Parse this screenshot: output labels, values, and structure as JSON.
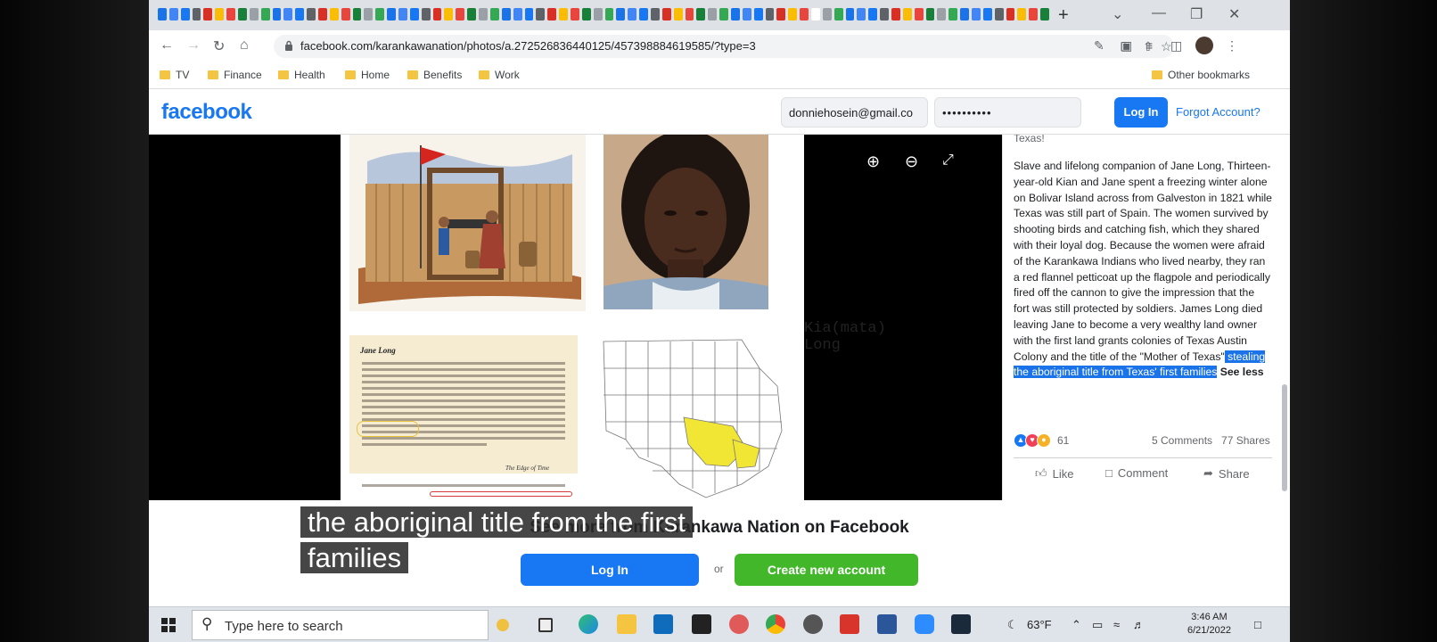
{
  "browser": {
    "url": "facebook.com/karankawanation/photos/a.272526836440125/457398884619585/?type=3",
    "bookmarks": [
      "TV",
      "Finance",
      "Health",
      "Home",
      "Benefits",
      "Work"
    ],
    "other_bookmarks": "Other bookmarks"
  },
  "fb_header": {
    "logo": "facebook",
    "email_value": "donniehosein@gmail.co",
    "password_value": "••••••••••",
    "login_label": "Log In",
    "forgot_label": "Forgot Account?"
  },
  "photo": {
    "caption_name": "Kia(mata) Long",
    "doc_title": "Jane Long",
    "doc_footer": "The Edge of Time"
  },
  "post": {
    "top_fragment": "Texas!",
    "body": "Slave and lifelong companion of Jane Long, Thirteen-year-old Kian and Jane spent a freezing winter alone on Bolivar Island across from Galveston in 1821 while Texas was still part of Spain. The women survived by shooting birds and catching fish, which they shared with their loyal dog. Because the women were afraid of the Karankawa Indians who lived nearby, they ran a red flannel petticoat up the flagpole and periodically fired off the cannon to give the impression that the fort was still protected by soldiers. James Long died leaving Jane to become a very wealthy land owner with the first land grants colonies of Texas Austin Colony and the title of the \"Mother of Texas\"",
    "highlighted": " stealing the aboriginal title from Texas' first families",
    "see_less": "See less",
    "reaction_count": "61",
    "comments": "5 Comments",
    "shares": "77 Shares",
    "actions": [
      "Like",
      "Comment",
      "Share"
    ]
  },
  "bottom": {
    "heading": "See more from Karankawa Nation on Facebook",
    "login_label": "Log In",
    "or_label": "or",
    "create_label": "Create new account"
  },
  "video_caption": {
    "line1": "the aboriginal title from the first",
    "line2": "families"
  },
  "taskbar": {
    "search_placeholder": "Type here to search",
    "weather": "63°F",
    "time": "3:46 AM",
    "date": "6/21/2022"
  },
  "colors": {
    "fb_blue": "#1877f2",
    "fb_green": "#42b72a",
    "highlight": "#1a73e8"
  }
}
